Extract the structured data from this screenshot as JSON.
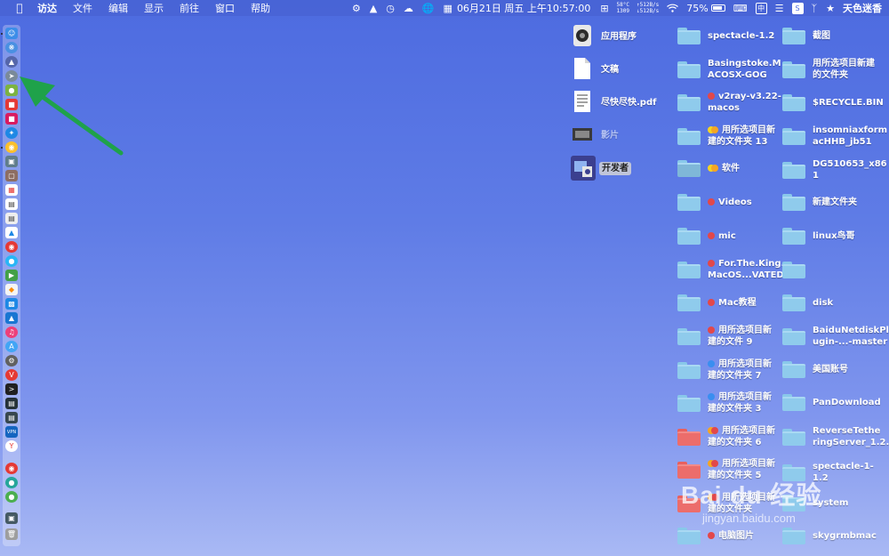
{
  "menubar": {
    "apple_icon": "apple-logo-icon",
    "app_name": "访达",
    "items": [
      "文件",
      "编辑",
      "显示",
      "前往",
      "窗口",
      "帮助"
    ],
    "status": {
      "temp": "58°C",
      "fan": "1309",
      "net_up": "↑512B/s",
      "net_down": "↓512B/s",
      "date": "06月21日 周五 上午10:57:00",
      "battery": "75%",
      "ime1": "中",
      "ime2": "S",
      "user": "天色迷香"
    }
  },
  "desktop": {
    "files": [
      {
        "label": "应用程序"
      },
      {
        "label": "文稿"
      },
      {
        "label": "尽快尽快.pdf"
      },
      {
        "label": "影片"
      },
      {
        "label": "开发者"
      }
    ],
    "col1": [
      {
        "line1": "spectacle-1.2",
        "line2": ""
      },
      {
        "line1": "Basingstoke.M",
        "line2": "ACOSX-GOG"
      },
      {
        "line1": "v2ray-v3.22-",
        "line2": "macos"
      },
      {
        "line1": "用所选项目新",
        "line2": "建的文件夹 13"
      },
      {
        "line1": "软件",
        "line2": ""
      },
      {
        "line1": "Videos",
        "line2": ""
      },
      {
        "line1": "mic",
        "line2": ""
      },
      {
        "line1": "For.The.King.",
        "line2": "MacOS...VATED"
      },
      {
        "line1": "Mac教程",
        "line2": ""
      },
      {
        "line1": "用所选项目新",
        "line2": "建的文件 9"
      },
      {
        "line1": "用所选项目新",
        "line2": "建的文件夹 7"
      },
      {
        "line1": "用所选项目新",
        "line2": "建的文件夹 3"
      },
      {
        "line1": "用所选项目新",
        "line2": "建的文件夹 6"
      },
      {
        "line1": "用所选项目新",
        "line2": "建的文件夹 5"
      },
      {
        "line1": "用所选项目新",
        "line2": "建的文件夹"
      },
      {
        "line1": "电脑图片",
        "line2": ""
      }
    ],
    "col2": [
      {
        "line1": "截图",
        "line2": ""
      },
      {
        "line1": "用所选项目新建",
        "line2": "的文件夹"
      },
      {
        "line1": "$RECYCLE.BIN",
        "line2": ""
      },
      {
        "line1": "insomniaxform",
        "line2": "acHHB_jb51"
      },
      {
        "line1": "DG510653_x86",
        "line2": "1"
      },
      {
        "line1": "新建文件夹",
        "line2": ""
      },
      {
        "line1": "linux鸟哥",
        "line2": ""
      },
      {
        "line1": "",
        "line2": ""
      },
      {
        "line1": "disk",
        "line2": ""
      },
      {
        "line1": "BaiduNetdiskPl",
        "line2": "ugin-...-master"
      },
      {
        "line1": "美国账号",
        "line2": ""
      },
      {
        "line1": "PanDownload",
        "line2": ""
      },
      {
        "line1": "ReverseTethe",
        "line2": "ringServer_1.2.0"
      },
      {
        "line1": "spectacle-1-1.2",
        "line2": ""
      },
      {
        "line1": "system",
        "line2": ""
      },
      {
        "line1": "skygrmbmac",
        "line2": ""
      }
    ]
  },
  "watermark": {
    "main": "Bai du 经验",
    "sub": "jingyan.baidu.com"
  },
  "colors": {
    "desktop_top": "#4d6be0",
    "desktop_bottom": "#a9b9f4",
    "folder": "#8fcbec",
    "folder_red": "#ec6d6b",
    "arrow": "#1fa24a"
  }
}
